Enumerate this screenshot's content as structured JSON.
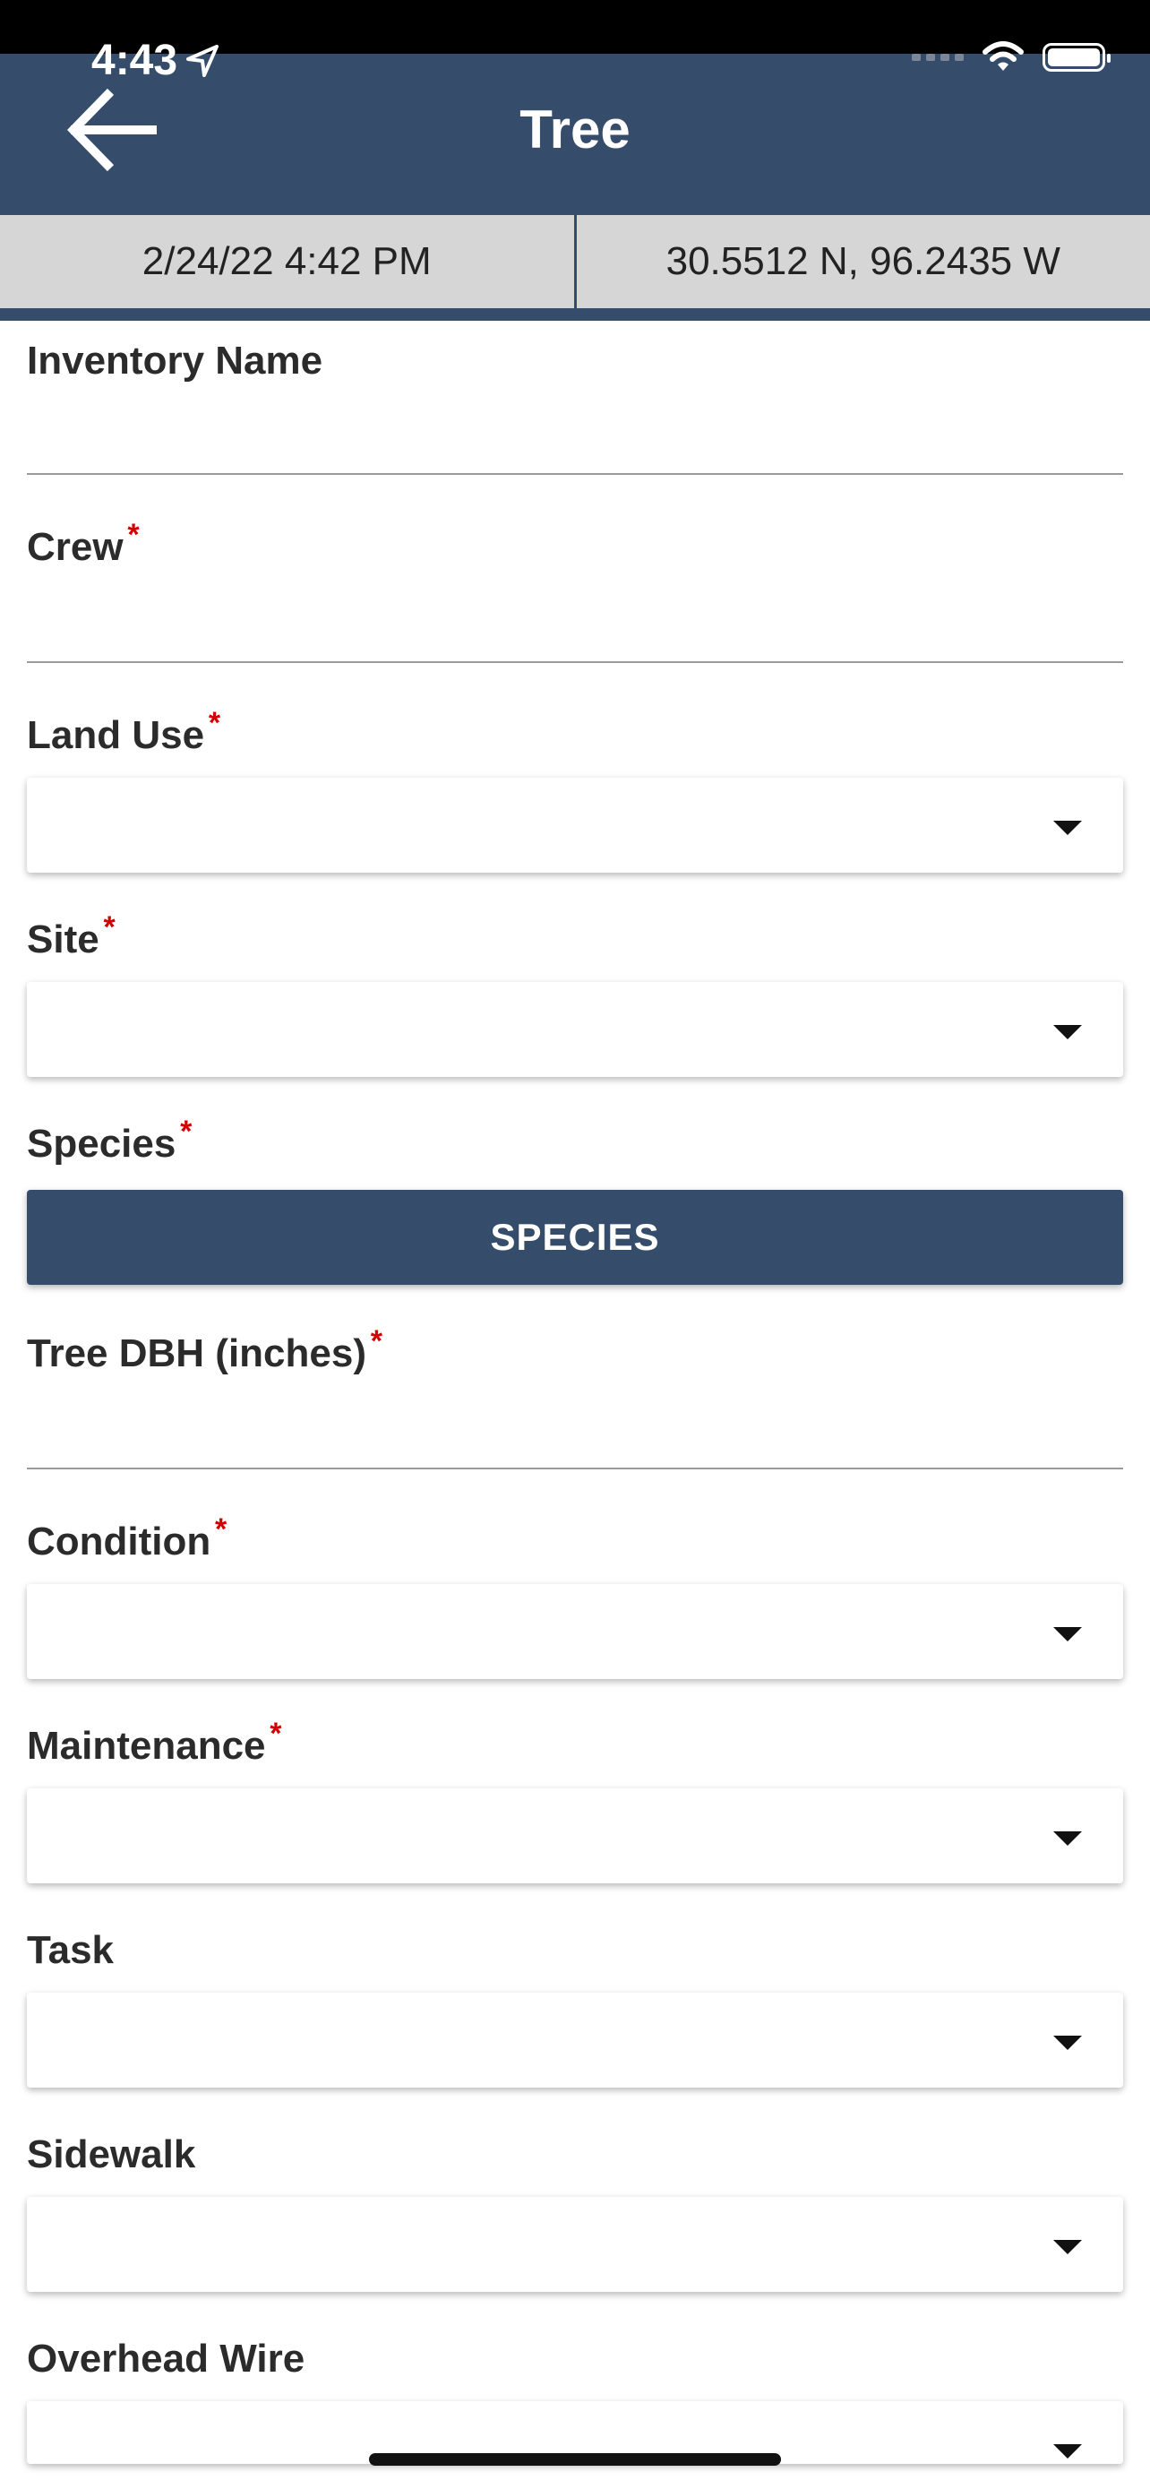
{
  "status_bar": {
    "time": "4:43"
  },
  "header": {
    "title": "Tree",
    "back_icon": "arrow-left-icon"
  },
  "info_bar": {
    "datetime": "2/24/22 4:42 PM",
    "coordinates": "30.5512 N, 96.2435 W"
  },
  "colors": {
    "header_bg": "#354d6b",
    "info_bg": "#d6d6d6",
    "required": "#d40000"
  },
  "form": {
    "inventory_name_label": "Inventory Name",
    "crew_label": "Crew",
    "land_use_label": "Land Use",
    "site_label": "Site",
    "species_label": "Species",
    "species_button": "SPECIES",
    "tree_dbh_label": "Tree DBH (inches)",
    "condition_label": "Condition",
    "maintenance_label": "Maintenance",
    "task_label": "Task",
    "sidewalk_label": "Sidewalk",
    "overhead_wire_label": "Overhead Wire",
    "required_marker": "*"
  }
}
